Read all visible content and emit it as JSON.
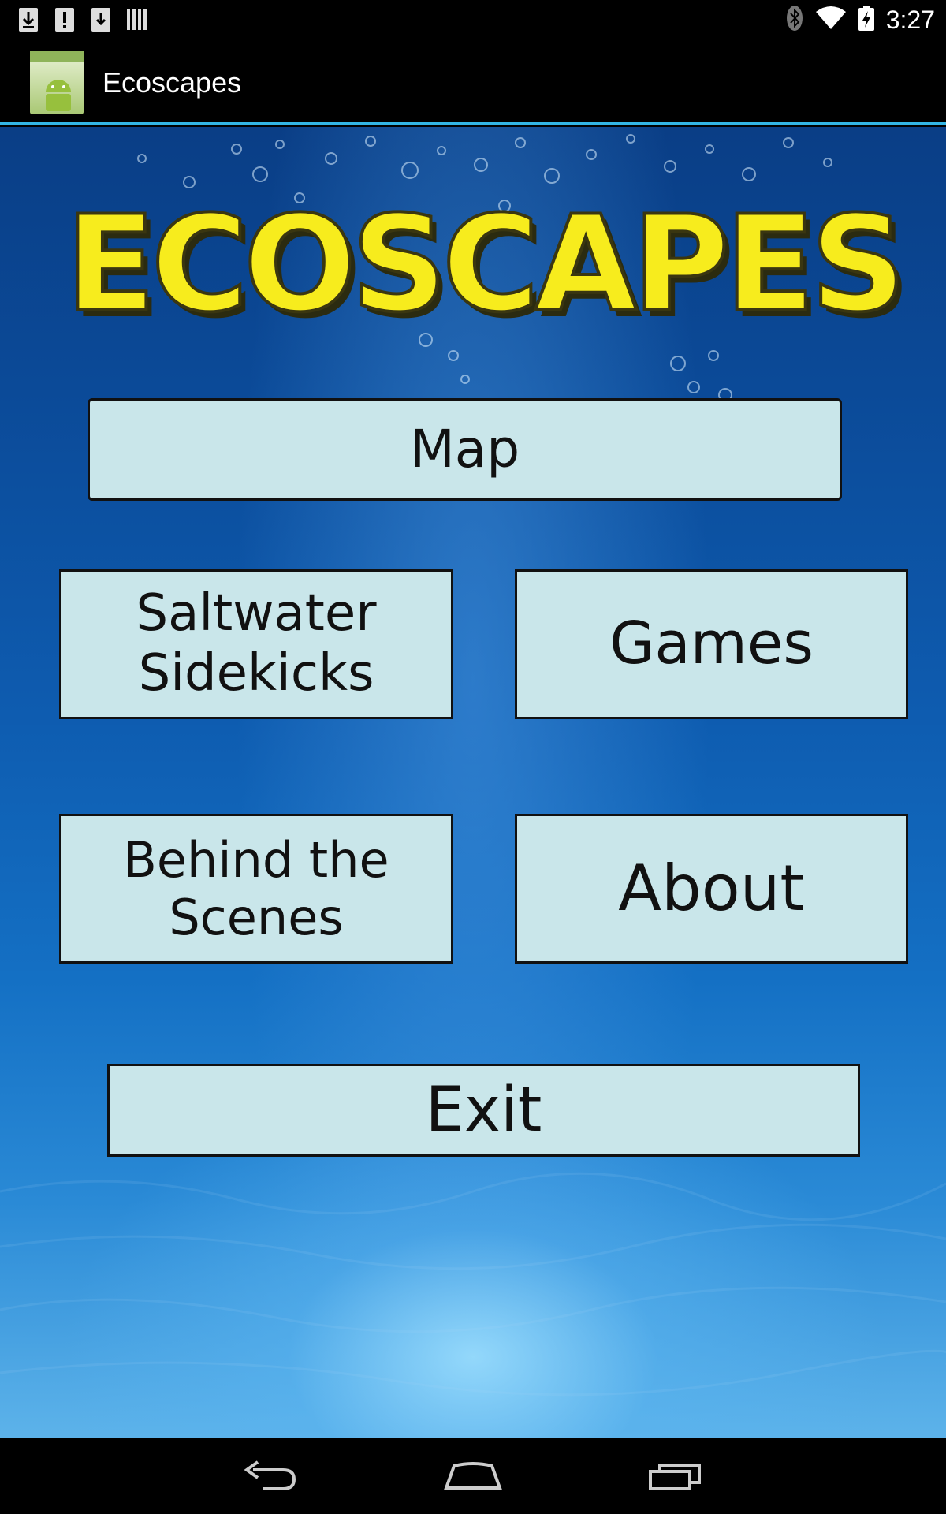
{
  "status_bar": {
    "time": "3:27",
    "left_icons": [
      "download-icon",
      "alert-icon",
      "download-icon",
      "barcode-icon"
    ],
    "right_icons": [
      "bluetooth-icon",
      "wifi-icon",
      "battery-charging-icon"
    ]
  },
  "action_bar": {
    "app_icon": "android-app-icon",
    "title": "Ecoscapes"
  },
  "main": {
    "logo_text": "ECOSCAPES",
    "buttons": {
      "map": "Map",
      "saltwater": "Saltwater\nSidekicks",
      "games": "Games",
      "behind": "Behind the\nScenes",
      "about": "About",
      "exit": "Exit"
    }
  },
  "nav_bar": {
    "icons": [
      "back-icon",
      "home-icon",
      "recent-apps-icon"
    ]
  },
  "colors": {
    "button_bg": "#c9e6ea",
    "logo_fill": "#f7ec1d",
    "action_bar_divider": "#33b5e5"
  }
}
